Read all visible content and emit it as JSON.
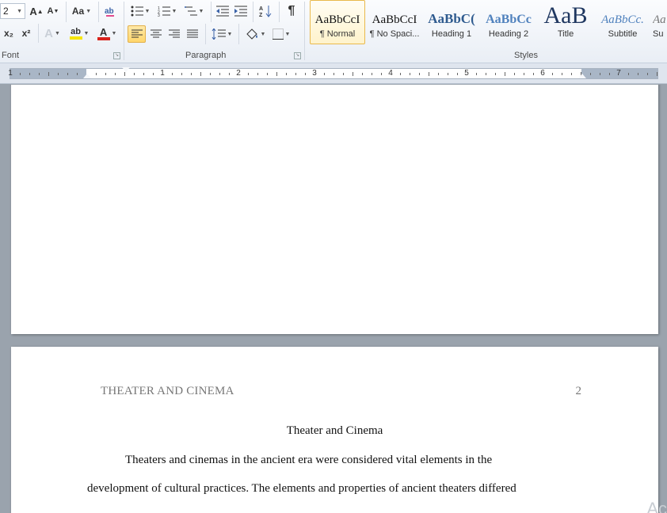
{
  "ribbon": {
    "font_group": {
      "label": "Font",
      "size_value": "2",
      "grow_font": "A",
      "shrink_font": "A",
      "change_case": "Aa",
      "subscript": "x₂",
      "superscript": "x²",
      "text_effects": "A",
      "highlight": "ab",
      "font_color": "A",
      "highlight_color": "#f7e600",
      "font_color_bar": "#d9231c"
    },
    "paragraph_group": {
      "label": "Paragraph",
      "pilcrow": "¶"
    },
    "styles_group": {
      "label": "Styles",
      "items": [
        {
          "preview": "AaBbCcI",
          "name": "¶ Normal"
        },
        {
          "preview": "AaBbCcI",
          "name": "¶ No Spaci..."
        },
        {
          "preview": "AaBbC(",
          "name": "Heading 1"
        },
        {
          "preview": "AaBbCc",
          "name": "Heading 2"
        },
        {
          "preview": "AaB",
          "name": "Title"
        },
        {
          "preview": "AaBbCc.",
          "name": "Subtitle"
        },
        {
          "preview": "Aa",
          "name": "Su"
        }
      ],
      "heading_color": "#2f5b8f",
      "title_color": "#1f3760",
      "subtitle_color": "#4f81bd"
    }
  },
  "ruler": {
    "numbers": [
      "1",
      "1",
      "2",
      "3",
      "4",
      "5",
      "6",
      "7"
    ]
  },
  "document": {
    "header_text": "THEATER AND CINEMA",
    "page_number": "2",
    "title": "Theater and Cinema",
    "lines": [
      "Theaters and cinemas in the ancient era were considered vital elements in the",
      "development of cultural practices. The elements and properties of ancient theaters differed"
    ],
    "watermark": "Ac"
  }
}
